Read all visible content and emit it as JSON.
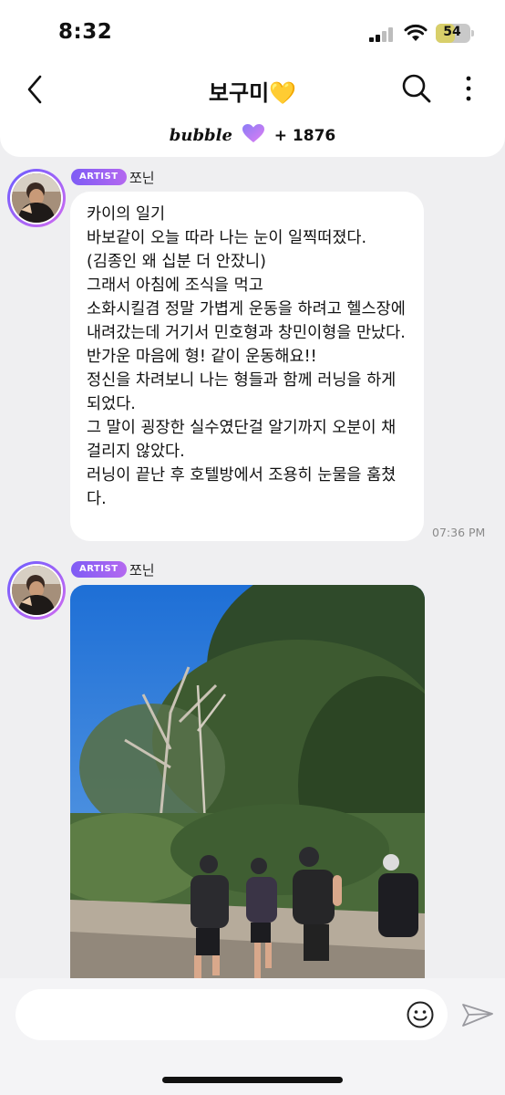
{
  "status_bar": {
    "time": "8:32",
    "battery": "54"
  },
  "header": {
    "title": "보구미",
    "title_emoji": "💛",
    "subtitle_brand": "bubble",
    "subtitle_count": "+ 1876"
  },
  "messages": [
    {
      "badge": "ARTIST",
      "sender": "쪼닌",
      "text": "카이의 일기\n바보같이 오늘 따라 나는 눈이 일찍떠졌다.\n(김종인 왜 십분 더 안잤니)\n그래서 아침에 조식을 먹고\n소화시킬겸 정말 가볍게 운동을 하려고 헬스장에 내려갔는데 거기서 민호형과 창민이형을 만났다.\n반가운 마음에 형! 같이 운동해요!!\n정신을 차려보니 나는 형들과 함께 러닝을 하게 되었다.\n그 말이 굉장한 실수였단걸 알기까지 오분이 채 걸리지 않았다.\n러닝이 끝난 후 호텔방에서 조용히 눈물을 훔쳤다.",
      "time": "07:36 PM"
    },
    {
      "badge": "ARTIST",
      "sender": "쪼닌",
      "image": "photo of four people running on a path under trees"
    }
  ],
  "composer": {
    "emoji_icon": "smiley-icon",
    "send_icon": "send-icon"
  },
  "colors": {
    "accent_start": "#7e5cf5",
    "accent_end": "#b468f0",
    "background": "#efeff1"
  }
}
